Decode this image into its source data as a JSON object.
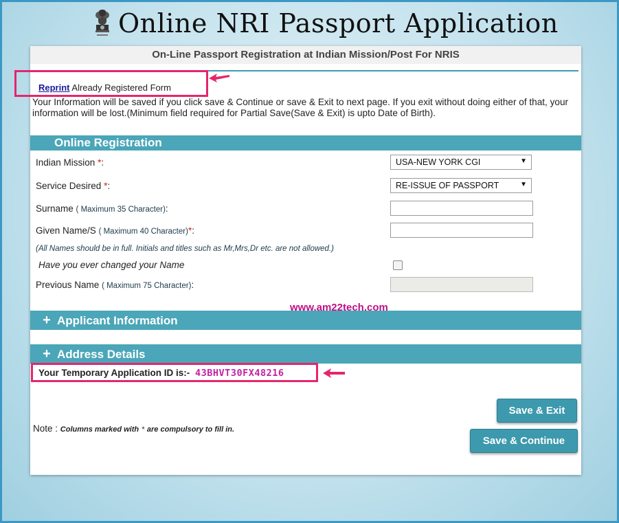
{
  "header": {
    "title": "Online NRI Passport Application",
    "emblem_icon": "national-emblem-icon"
  },
  "card": {
    "title": "On-Line Passport Registration at Indian Mission/Post For NRIS",
    "reprint_link": "Reprint",
    "reprint_text": "Already Registered Form",
    "info": "Your Information will be saved if you click save & Continue or save & Exit to next page. If you exit without  doing either of that, your information will be lost.(Minimum field required for Partial Save(Save & Exit) is upto  Date of Birth)."
  },
  "online_registration": {
    "title": "Online Registration",
    "indian_mission_label": "Indian Mission",
    "indian_mission_value": "USA-NEW YORK CGI",
    "service_label": "Service Desired",
    "service_value": "RE-ISSUE OF PASSPORT",
    "surname_label": "Surname",
    "surname_hint": "( Maximum 35 Character)",
    "given_name_label": "Given Name/S",
    "given_name_hint": "( Maximum 40 Character)",
    "names_note": "(All Names should be in full. Initials and titles such as Mr,Mrs,Dr etc. are not allowed.)",
    "changed_name_label": "Have you ever changed your Name",
    "previous_name_label": "Previous Name",
    "previous_name_hint": "( Maximum 75 Character)",
    "required_mark": "*",
    "colon": ":"
  },
  "watermark": "www.am22tech.com",
  "applicant_section": {
    "title": "Applicant Information",
    "icon": "plus-icon"
  },
  "address_section": {
    "title": "Address Details",
    "icon": "plus-icon"
  },
  "temp_id": {
    "label": "Your Temporary Application ID is:-",
    "value": "43BHVT30FX48216"
  },
  "note": {
    "label": "Note :",
    "text_before": "Columns marked with",
    "text_after": "are compulsory to fill in."
  },
  "buttons": {
    "save_exit": "Save & Exit",
    "save_continue": "Save & Continue"
  },
  "colors": {
    "teal": "#4aa6b8",
    "highlight": "#e5256e",
    "id_color": "#c31fa6"
  }
}
